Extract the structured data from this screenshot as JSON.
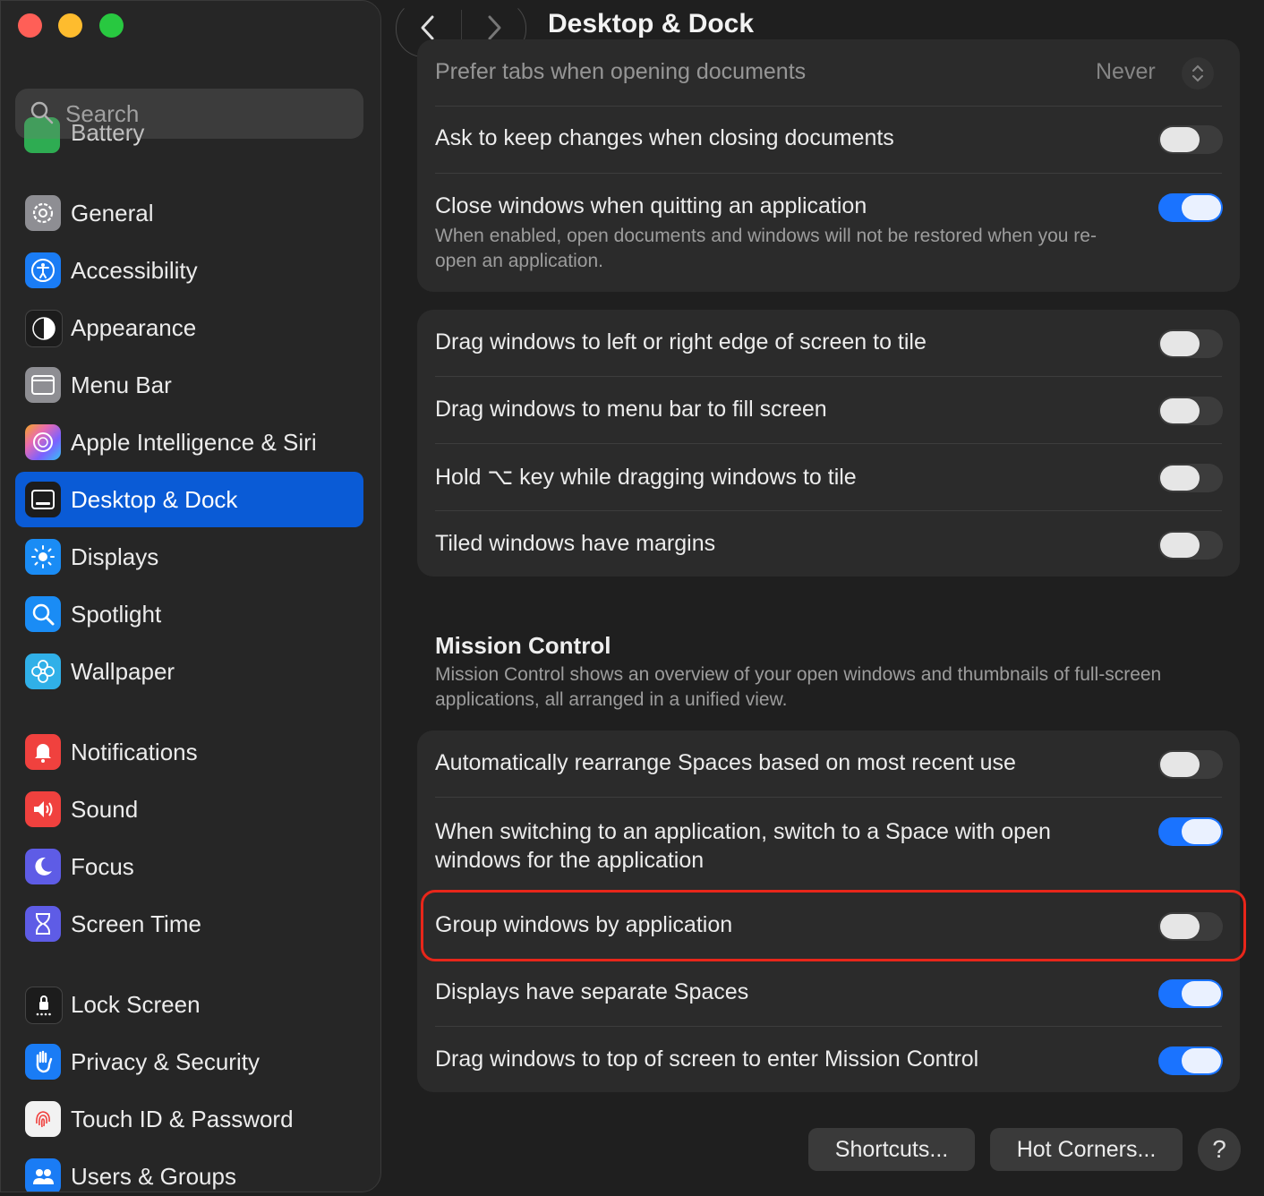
{
  "window": {
    "title": "Desktop & Dock"
  },
  "sidebar": {
    "search_placeholder": "Search",
    "ghost_item": "Battery",
    "items": [
      {
        "label": "General",
        "icon": "gear-icon",
        "color": "#8e8e93"
      },
      {
        "label": "Accessibility",
        "icon": "accessibility-icon",
        "color": "#1a7cf5"
      },
      {
        "label": "Appearance",
        "icon": "appearance-icon",
        "color": "#1c1c1c"
      },
      {
        "label": "Menu Bar",
        "icon": "menu-bar-icon",
        "color": "#8e8e93"
      },
      {
        "label": "Apple Intelligence & Siri",
        "icon": "siri-icon",
        "color": "#e86bb0"
      },
      {
        "label": "Desktop & Dock",
        "icon": "dock-icon",
        "color": "#1c1c1c",
        "active": true
      },
      {
        "label": "Displays",
        "icon": "displays-icon",
        "color": "#1a8cf5"
      },
      {
        "label": "Spotlight",
        "icon": "spotlight-icon",
        "color": "#1a8cf5"
      },
      {
        "label": "Wallpaper",
        "icon": "wallpaper-icon",
        "color": "#30b0e8"
      },
      {
        "label": "Notifications",
        "icon": "notifications-icon",
        "color": "#f0413e"
      },
      {
        "label": "Sound",
        "icon": "sound-icon",
        "color": "#f0413e"
      },
      {
        "label": "Focus",
        "icon": "focus-icon",
        "color": "#5e5ce6"
      },
      {
        "label": "Screen Time",
        "icon": "screen-time-icon",
        "color": "#5e5ce6"
      },
      {
        "label": "Lock Screen",
        "icon": "lock-screen-icon",
        "color": "#1c1c1c"
      },
      {
        "label": "Privacy & Security",
        "icon": "privacy-hand-icon",
        "color": "#1a7cf5"
      },
      {
        "label": "Touch ID & Password",
        "icon": "fingerprint-icon",
        "color": "#f2f2f2"
      },
      {
        "label": "Users & Groups",
        "icon": "users-icon",
        "color": "#1a7cf5"
      }
    ]
  },
  "windows_group": {
    "prefer_tabs": {
      "label": "Prefer tabs when opening documents",
      "value": "Never"
    },
    "ask_keep": {
      "label": "Ask to keep changes when closing documents",
      "on": false
    },
    "close_windows": {
      "label": "Close windows when quitting an application",
      "desc": "When enabled, open documents and windows will not be restored when you re-open an application.",
      "on": true
    }
  },
  "tiling_group": {
    "rows": [
      {
        "label": "Drag windows to left or right edge of screen to tile",
        "on": false
      },
      {
        "label": "Drag windows to menu bar to fill screen",
        "on": false
      },
      {
        "label": "Hold ⌥ key while dragging windows to tile",
        "on": false
      },
      {
        "label": "Tiled windows have margins",
        "on": false
      }
    ]
  },
  "mission_control": {
    "title": "Mission Control",
    "desc": "Mission Control shows an overview of your open windows and thumbnails of full-screen applications, all arranged in a unified view.",
    "rows": [
      {
        "label": "Automatically rearrange Spaces based on most recent use",
        "on": false
      },
      {
        "label": "When switching to an application, switch to a Space with open windows for the application",
        "on": true
      },
      {
        "label": "Group windows by application",
        "on": false
      },
      {
        "label": "Displays have separate Spaces",
        "on": true
      },
      {
        "label": "Drag windows to top of screen to enter Mission Control",
        "on": true
      }
    ]
  },
  "footer": {
    "shortcuts": "Shortcuts...",
    "hot_corners": "Hot Corners...",
    "help": "?"
  },
  "colors": {
    "accent": "#0a5bd6",
    "toggle_on": "#1a73ff",
    "highlight": "#e8261a"
  }
}
